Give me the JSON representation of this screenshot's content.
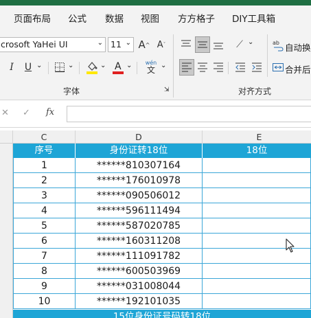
{
  "ribbon_tabs": [
    "页面布局",
    "公式",
    "数据",
    "视图",
    "方方格子",
    "DIY工具箱"
  ],
  "font": {
    "name": "crosoft YaHei UI",
    "size": "11",
    "increase_label": "A",
    "decrease_label": "A",
    "bold_label": "I",
    "underline_label": "U",
    "phonetic_label": "wén",
    "group_label": "字体"
  },
  "alignment": {
    "wrap_label": "自动换",
    "merge_label": "合并后",
    "group_label": "对齐方式"
  },
  "formula_bar": {
    "cancel": "✕",
    "confirm": "✓",
    "fx": "fx",
    "value": ""
  },
  "columns": [
    "C",
    "D",
    "E"
  ],
  "table": {
    "headers": [
      "序号",
      "身份证转18位",
      "18位"
    ],
    "rows": [
      {
        "no": "1",
        "id": "******810307164",
        "id18": ""
      },
      {
        "no": "2",
        "id": "******176010978",
        "id18": ""
      },
      {
        "no": "3",
        "id": "******090506012",
        "id18": ""
      },
      {
        "no": "4",
        "id": "******596111494",
        "id18": ""
      },
      {
        "no": "5",
        "id": "******587020785",
        "id18": ""
      },
      {
        "no": "6",
        "id": "******160311208",
        "id18": ""
      },
      {
        "no": "7",
        "id": "******111091782",
        "id18": ""
      },
      {
        "no": "8",
        "id": "******600503969",
        "id18": ""
      },
      {
        "no": "9",
        "id": "******031008044",
        "id18": ""
      },
      {
        "no": "10",
        "id": "******192101035",
        "id18": ""
      }
    ],
    "footer": "15位身份证号码转18位"
  },
  "colors": {
    "header_bg": "#1ea5d6",
    "grid_line": "#3aa6d8",
    "ribbon_bg": "#f3f3f3",
    "highlight_yellow": "#ffe800",
    "font_red": "#e02020"
  }
}
